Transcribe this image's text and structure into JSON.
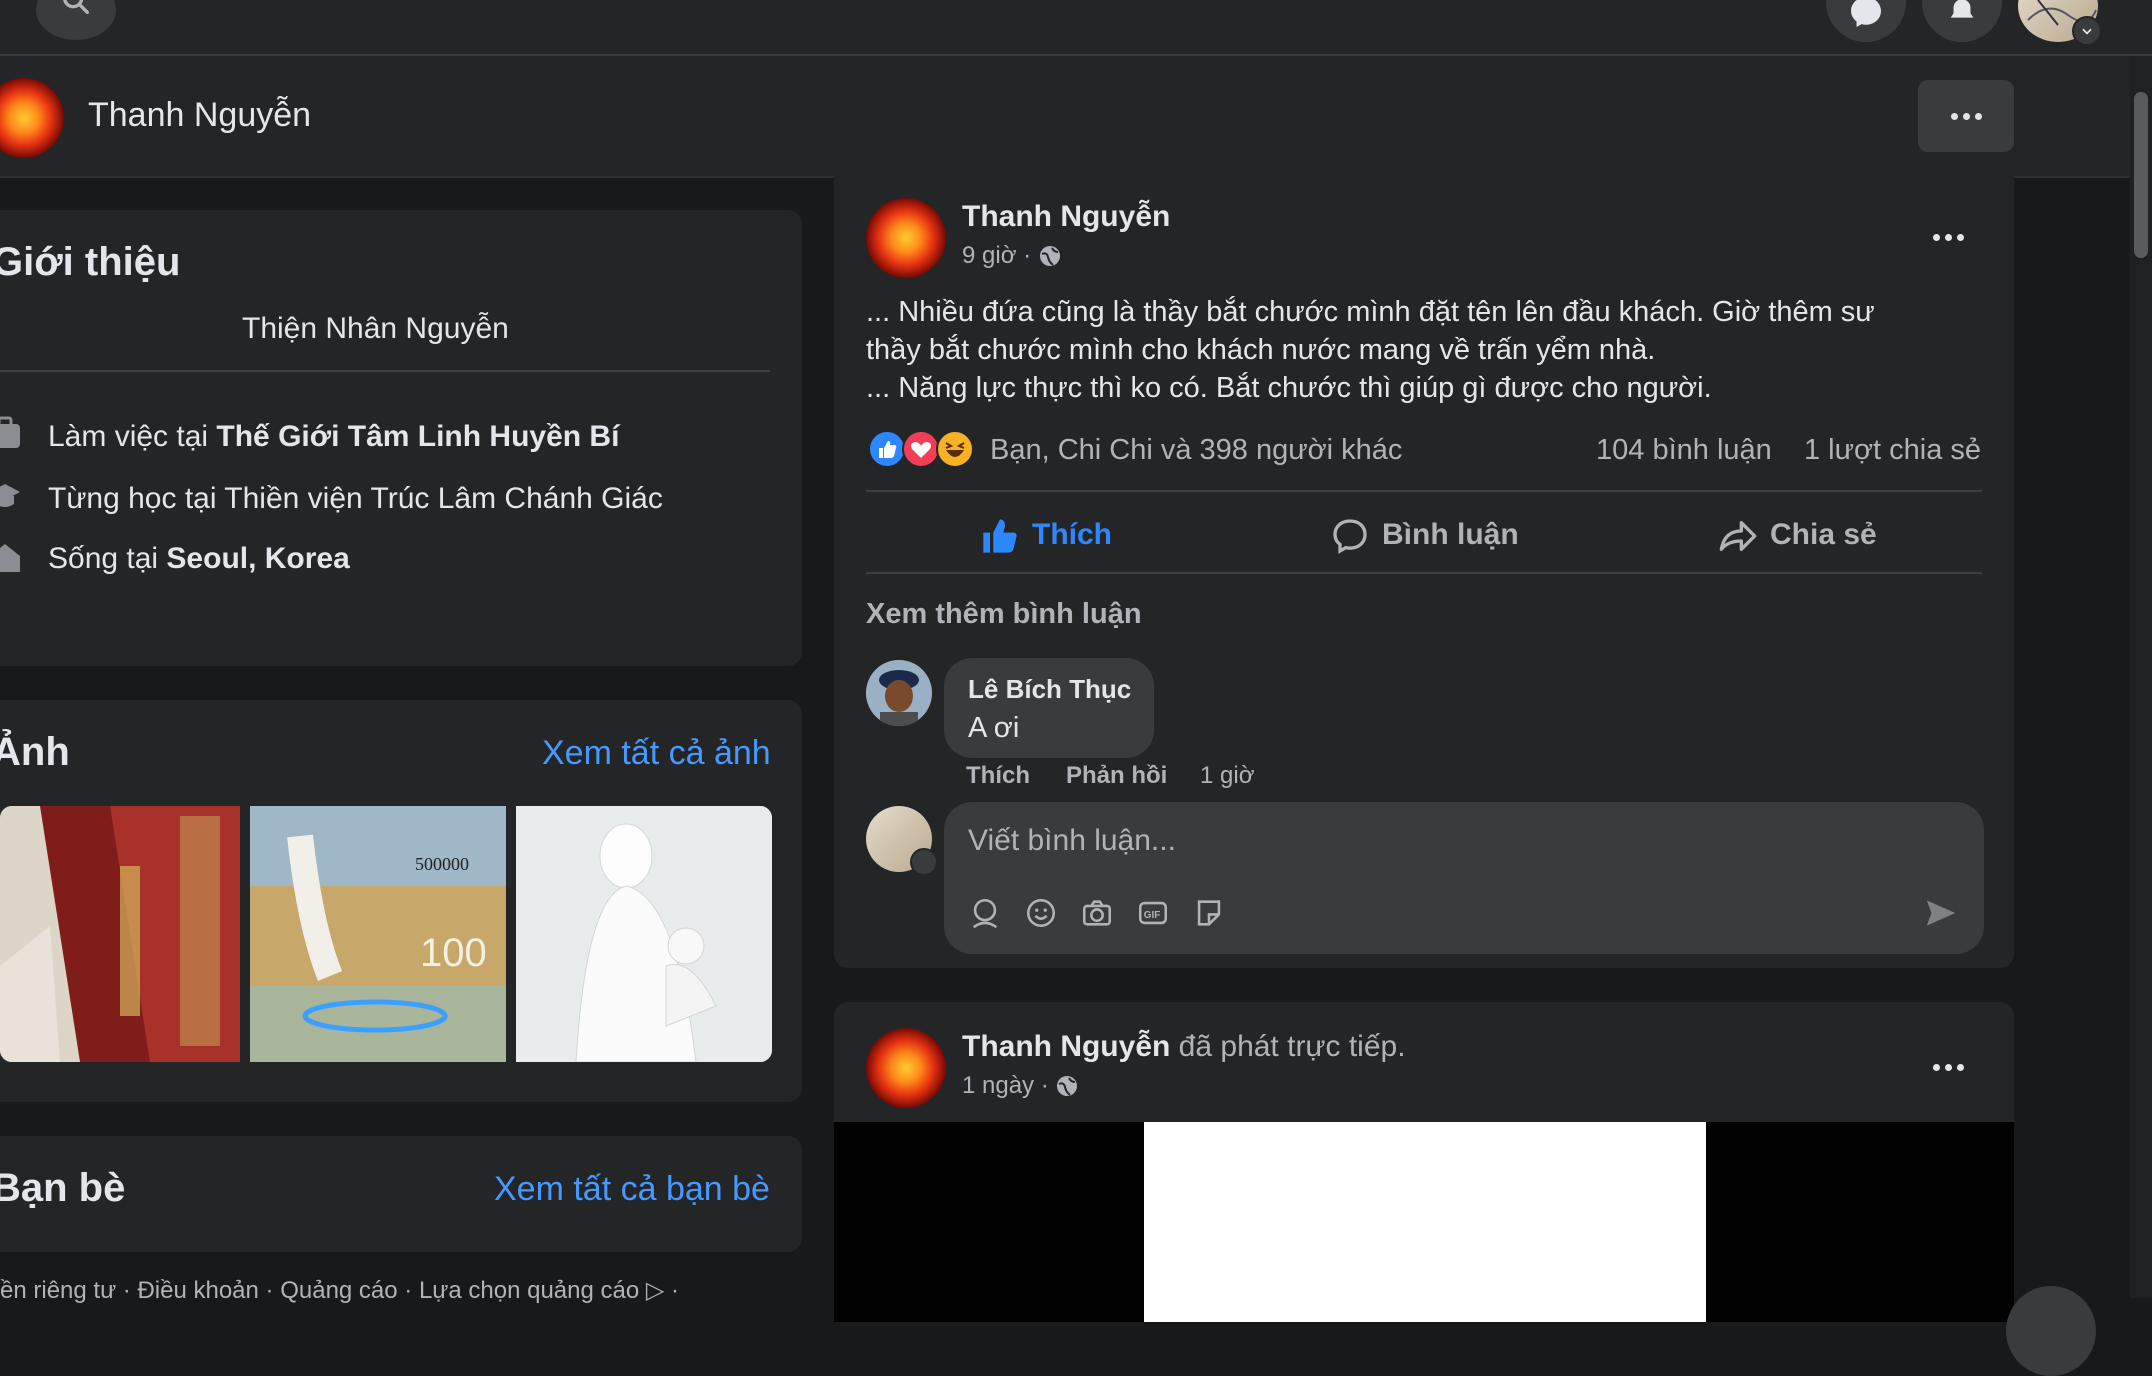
{
  "profile": {
    "name": "Thanh Nguyễn"
  },
  "intro": {
    "title": "Giới thiệu",
    "bio": "Thiện Nhân Nguyễn",
    "work_prefix": "Làm việc tại ",
    "work_place": "Thế Giới Tâm Linh Huyền Bí",
    "study": "Từng học tại Thiền viện Trúc Lâm Chánh Giác",
    "live_prefix": "Sống tại ",
    "live_place": "Seoul, Korea"
  },
  "photos": {
    "title": "Ảnh",
    "see_all": "Xem tất cả ảnh",
    "bill_text": "500000",
    "bill_text2": "100"
  },
  "friends": {
    "title": "Bạn bè",
    "see_all": "Xem tất cả bạn bè"
  },
  "footer_text": "ền riêng tư · Điều khoản · Quảng cáo · Lựa chọn quảng cáo ▷ ·",
  "post1": {
    "author": "Thanh Nguyễn",
    "time": "9 giờ · ",
    "body_line1": "... Nhiều đứa cũng là thầy bắt chước mình đặt tên lên đầu khách. Giờ thêm sư",
    "body_line2": "thầy bắt chước mình cho khách nước mang về trấn yểm nhà.",
    "body_line3": "... Năng lực thực thì ko có. Bắt chước  thì giúp gì được cho người.",
    "reactions_text": "Bạn, Chi Chi và 398 người khác",
    "comments_count": "104 bình luận",
    "shares_count": "1 lượt chia sẻ",
    "like_label": "Thích",
    "comment_label": "Bình luận",
    "share_label": "Chia sẻ",
    "view_more": "Xem thêm bình luận",
    "comment": {
      "author": "Lê Bích Thục",
      "text": "A ơi",
      "like": "Thích",
      "reply": "Phản hồi",
      "time": "1 giờ"
    },
    "input_placeholder": "Viết bình luận..."
  },
  "post2": {
    "author": "Thanh Nguyễn",
    "action": " đã phát trực tiếp.",
    "time": "1 ngày · "
  },
  "colors": {
    "background": "#18191a",
    "card": "#242526",
    "accent": "#4599ff",
    "like_blue": "#2d88ff"
  }
}
